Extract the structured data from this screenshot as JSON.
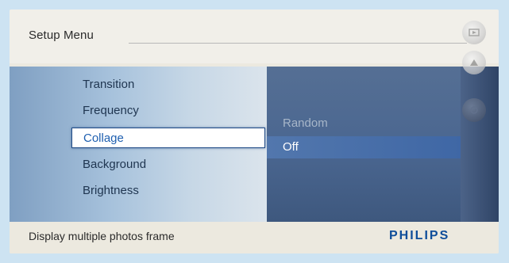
{
  "header": {
    "title": "Setup Menu"
  },
  "menu": {
    "items": [
      {
        "label": "Transition",
        "selected": false
      },
      {
        "label": "Frequency",
        "selected": false
      },
      {
        "label": "Collage",
        "selected": true
      },
      {
        "label": "Background",
        "selected": false
      },
      {
        "label": "Brightness",
        "selected": false
      }
    ]
  },
  "options": {
    "items": [
      {
        "label": "Random",
        "selected": false
      },
      {
        "label": "Off",
        "selected": true
      }
    ]
  },
  "footer": {
    "description": "Display multiple photos frame",
    "brand": "PHILIPS"
  },
  "side_buttons": [
    {
      "icon": "slideshow-icon"
    },
    {
      "icon": "up-arrow-icon"
    },
    {
      "icon": "menu-icon"
    }
  ],
  "colors": {
    "brand_blue": "#0e4d9a",
    "highlight": "#1e5fb0",
    "option_bg": "#4a6690"
  }
}
